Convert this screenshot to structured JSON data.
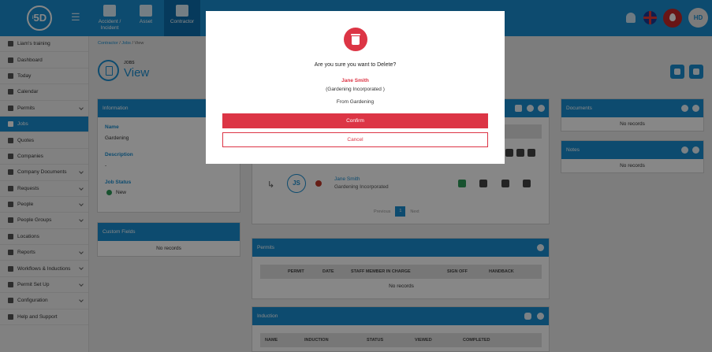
{
  "app": {
    "logo": "5D",
    "logo_prefix": "i"
  },
  "topnav": [
    {
      "label": "Accident / Incident",
      "icon": "first-aid-icon"
    },
    {
      "label": "Asset",
      "icon": "boxes-icon"
    },
    {
      "label": "Contractor",
      "icon": "hardhat-icon",
      "active": true
    }
  ],
  "user": {
    "initials": "HD"
  },
  "sidebar": {
    "items": [
      {
        "label": "Liam's training"
      },
      {
        "label": "Dashboard"
      },
      {
        "label": "Today"
      },
      {
        "label": "Calendar"
      },
      {
        "label": "Permits"
      },
      {
        "label": "Jobs"
      },
      {
        "label": "Quotes"
      },
      {
        "label": "Companies"
      },
      {
        "label": "Company Documents"
      },
      {
        "label": "Requests"
      },
      {
        "label": "People"
      },
      {
        "label": "People Groups"
      },
      {
        "label": "Locations"
      },
      {
        "label": "Reports"
      },
      {
        "label": "Workflows & Inductions"
      },
      {
        "label": "Permit Set Up"
      },
      {
        "label": "Configuration"
      },
      {
        "label": "Help and Support"
      }
    ]
  },
  "breadcrumb": {
    "part1": "Contractor",
    "part2": "Jobs",
    "part3": "View",
    "sep": "/"
  },
  "page": {
    "subtitle": "JOBS",
    "title": "View"
  },
  "information": {
    "header": "Information",
    "name_label": "Name",
    "name_value": "Gardening",
    "description_label": "Description",
    "description_value": "-",
    "status_label": "Job Status",
    "status_value": "New"
  },
  "custom_fields": {
    "header": "Custom Fields",
    "empty": "No records"
  },
  "contacts": {
    "initials": "JS",
    "name": "Jane Smith",
    "company": "Gardening Incorporated",
    "pager": {
      "prev": "Previous",
      "page": "1",
      "next": "Next"
    }
  },
  "permits": {
    "header": "Permits",
    "columns": [
      "PERMIT",
      "DATE",
      "STAFF MEMBER IN CHARGE",
      "SIGN OFF",
      "HANDBACK"
    ],
    "empty": "No records"
  },
  "induction": {
    "header": "Induction",
    "columns": [
      "NAME",
      "INDUCTION",
      "STATUS",
      "VIEWED",
      "COMPLETED"
    ]
  },
  "documents": {
    "header": "Documents",
    "empty": "No records"
  },
  "notes": {
    "header": "Notes",
    "empty": "No records"
  },
  "modal": {
    "question": "Are you sure you want to Delete?",
    "name": "Jane Smith",
    "company": "(Gardening Incorporated )",
    "from": "From Gardening",
    "confirm": "Confirm",
    "cancel": "Cancel"
  },
  "colors": {
    "primary": "#1a8fd1",
    "danger": "#dc3545",
    "success": "#2e9b5a"
  }
}
